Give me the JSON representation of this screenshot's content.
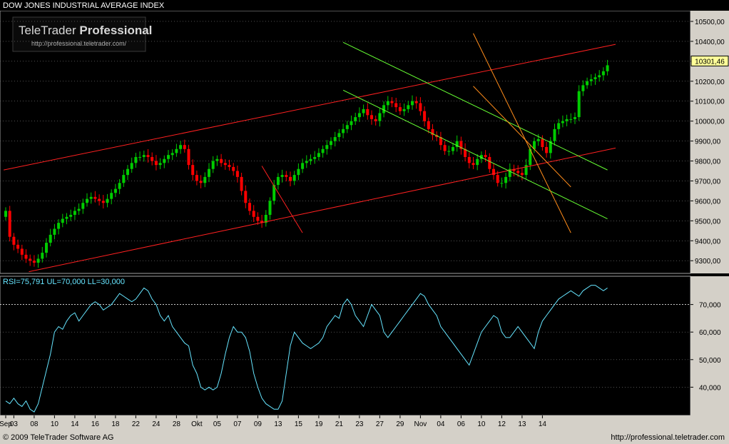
{
  "title": "DOW JONES INDUSTRIAL AVERAGE INDEX",
  "watermark": {
    "brand_regular": "TeleTrader",
    "brand_bold": "Professional",
    "url": "http://professional.teletrader.com/"
  },
  "footer": {
    "copyright": "© 2009 TeleTrader Software AG",
    "url": "http://professional.teletrader.com"
  },
  "colors": {
    "background": "#000000",
    "frame": "#b0b0b0",
    "up": "#00cc00",
    "down": "#ff0000",
    "rsi": "#66e5ff",
    "channel_red": "#ff2020",
    "channel_green": "#66ff33",
    "channel_orange": "#ff8c1a",
    "grid": "#808080"
  },
  "chart_data": [
    {
      "type": "candlestick",
      "title": "DOW JONES INDUSTRIAL AVERAGE INDEX",
      "ylim": [
        9240,
        10550
      ],
      "y_ticks": [
        "10500,00",
        "10400,00",
        "10300,00",
        "10200,00",
        "10100,00",
        "10000,00",
        "9900,00",
        "9800,00",
        "9700,00",
        "9600,00",
        "9500,00",
        "9400,00",
        "9300,00"
      ],
      "y_tick_values": [
        10500,
        10400,
        10300,
        10200,
        10100,
        10000,
        9900,
        9800,
        9700,
        9600,
        9500,
        9400,
        9300
      ],
      "last_value_label": "10301,46",
      "last_value": 10301.46,
      "grid": true,
      "x_ticks": [
        "Sep",
        "03",
        "08",
        "10",
        "14",
        "16",
        "18",
        "22",
        "24",
        "28",
        "Okt",
        "05",
        "07",
        "09",
        "13",
        "15",
        "19",
        "21",
        "23",
        "27",
        "29",
        "Nov",
        "04",
        "06",
        "10",
        "12",
        "13",
        "14"
      ],
      "x_tick_index": [
        0,
        2,
        7,
        12,
        17,
        22,
        27,
        32,
        37,
        42,
        47,
        52,
        57,
        62,
        67,
        72,
        77,
        82,
        87,
        92,
        97,
        102,
        107,
        112,
        117,
        122,
        127,
        132
      ],
      "closes": [
        9550,
        9420,
        9380,
        9360,
        9330,
        9310,
        9300,
        9290,
        9310,
        9340,
        9390,
        9430,
        9460,
        9490,
        9510,
        9520,
        9530,
        9550,
        9560,
        9590,
        9610,
        9620,
        9610,
        9600,
        9590,
        9610,
        9640,
        9660,
        9690,
        9730,
        9760,
        9790,
        9820,
        9820,
        9830,
        9820,
        9800,
        9780,
        9790,
        9810,
        9830,
        9840,
        9860,
        9880,
        9860,
        9780,
        9730,
        9700,
        9690,
        9720,
        9760,
        9800,
        9810,
        9790,
        9780,
        9770,
        9750,
        9720,
        9650,
        9590,
        9550,
        9520,
        9500,
        9490,
        9530,
        9600,
        9680,
        9720,
        9730,
        9720,
        9700,
        9730,
        9760,
        9790,
        9800,
        9810,
        9820,
        9840,
        9860,
        9880,
        9900,
        9920,
        9940,
        9960,
        9980,
        10000,
        10020,
        10040,
        10060,
        10030,
        10010,
        10000,
        10040,
        10080,
        10100,
        10090,
        10070,
        10050,
        10060,
        10080,
        10100,
        10090,
        10050,
        10000,
        9960,
        9930,
        9920,
        9880,
        9850,
        9850,
        9870,
        9900,
        9860,
        9820,
        9790,
        9780,
        9810,
        9830,
        9820,
        9760,
        9730,
        9690,
        9690,
        9720,
        9760,
        9750,
        9740,
        9730,
        9780,
        9860,
        9900,
        9910,
        9870,
        9840,
        9900,
        9960,
        9990,
        10000,
        10010,
        10010,
        10020,
        10150,
        10180,
        10200,
        10210,
        10220,
        10230,
        10250,
        10280
      ],
      "trendlines": [
        {
          "color": "channel_red",
          "points": [
            [
              -0.5,
              9755
            ],
            [
              150,
              10385
            ]
          ]
        },
        {
          "color": "channel_red",
          "points": [
            [
              5.7,
              9245
            ],
            [
              150,
              9865
            ]
          ]
        },
        {
          "color": "channel_green",
          "points": [
            [
              83,
              10395
            ],
            [
              148,
              9755
            ]
          ]
        },
        {
          "color": "channel_green",
          "points": [
            [
              83,
              10155
            ],
            [
              148,
              9510
            ]
          ]
        },
        {
          "color": "channel_orange",
          "points": [
            [
              115,
              10440
            ],
            [
              139,
              9440
            ]
          ]
        },
        {
          "color": "channel_orange",
          "points": [
            [
              115,
              10175
            ],
            [
              139,
              9670
            ]
          ]
        },
        {
          "color": "channel_red",
          "points": [
            [
              63,
              9775
            ],
            [
              73,
              9440
            ]
          ]
        }
      ]
    },
    {
      "type": "line",
      "title": "RSI=75,791 UL=70,000 LL=30,000",
      "ylim": [
        30,
        80
      ],
      "y_ticks": [
        "70,000",
        "60,000",
        "50,000",
        "40,000"
      ],
      "y_tick_values": [
        70,
        60,
        50,
        40
      ],
      "upper_level": 70,
      "lower_level": 30,
      "last_value": 75.791,
      "series": [
        {
          "values": [
            35,
            34,
            36,
            34,
            33,
            35,
            32,
            31,
            34,
            40,
            46,
            52,
            60,
            62,
            61,
            64,
            66,
            67,
            64,
            66,
            68,
            70,
            71,
            70,
            68,
            69,
            70,
            72,
            74,
            73,
            72,
            71,
            72,
            74,
            76,
            75,
            72,
            70,
            66,
            64,
            66,
            62,
            60,
            58,
            56,
            55,
            48,
            45,
            40,
            39,
            40,
            39,
            40,
            45,
            52,
            58,
            62,
            60,
            60,
            58,
            53,
            45,
            40,
            36,
            34,
            33,
            32,
            32,
            35,
            45,
            55,
            60,
            58,
            56,
            55,
            54,
            55,
            56,
            58,
            62,
            64,
            66,
            65,
            70,
            72,
            70,
            66,
            64,
            62,
            66,
            70,
            68,
            66,
            60,
            58,
            60,
            62,
            64,
            66,
            68,
            70,
            72,
            74,
            73,
            70,
            68,
            66,
            62,
            60,
            58,
            56,
            54,
            52,
            50,
            48,
            52,
            56,
            60,
            62,
            64,
            66,
            65,
            60,
            58,
            58,
            60,
            62,
            60,
            58,
            56,
            54,
            60,
            64,
            66,
            68,
            70,
            72,
            73,
            74,
            75,
            74,
            73,
            75,
            76,
            77,
            77,
            76,
            75,
            76
          ]
        }
      ]
    }
  ]
}
